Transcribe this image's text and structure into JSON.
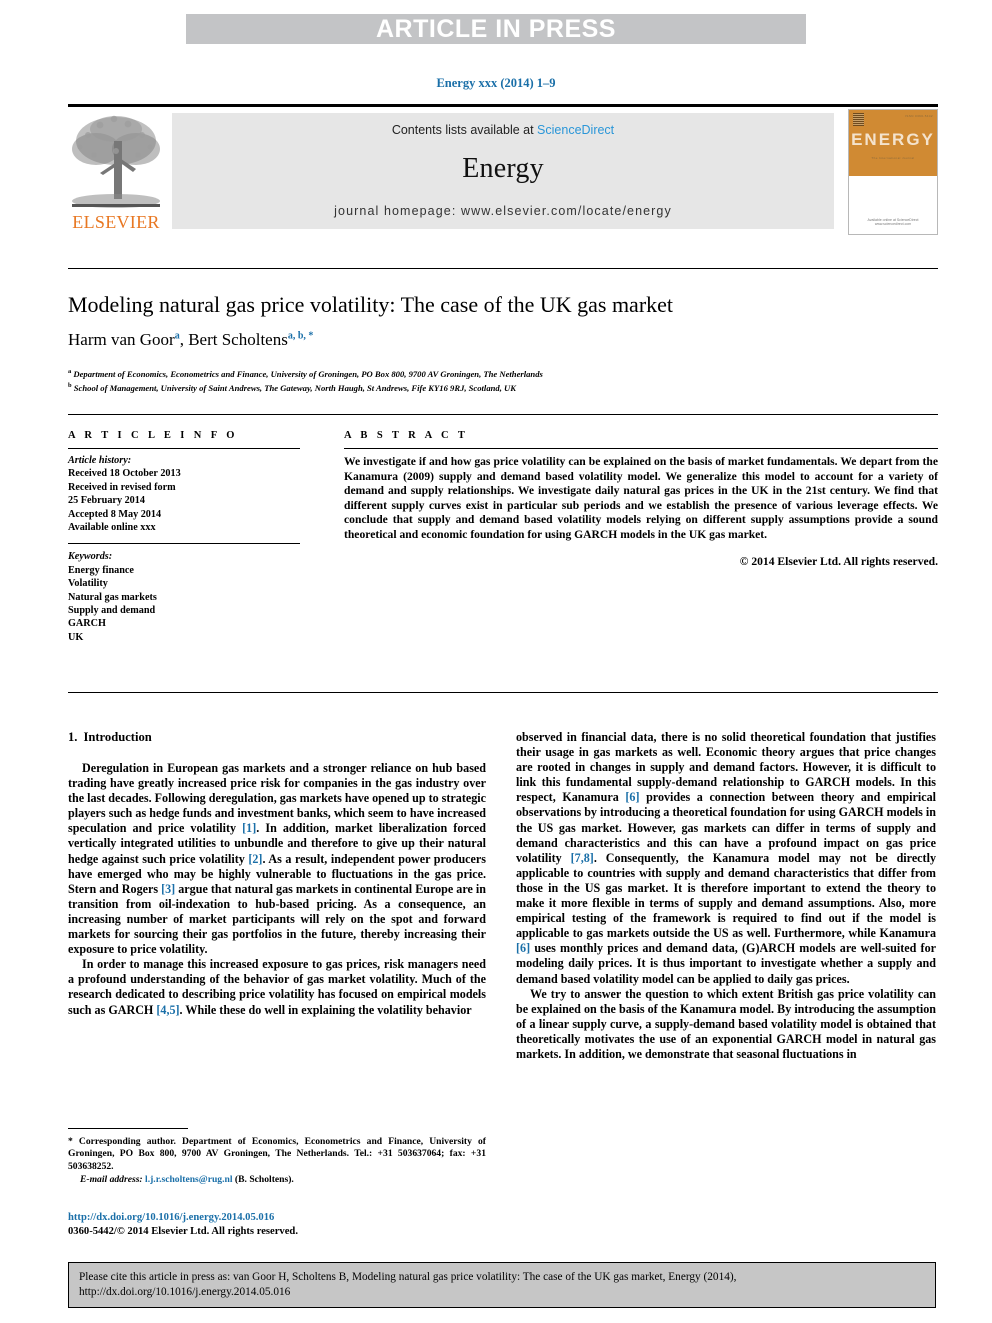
{
  "banner": {
    "article_in_press": "ARTICLE IN PRESS"
  },
  "journal_ref": "Energy xxx (2014) 1–9",
  "masthead": {
    "publisher_name": "ELSEVIER",
    "contents_prefix": "Contents lists available at ",
    "sciencedirect": "ScienceDirect",
    "journal_title": "Energy",
    "homepage": "journal homepage: www.elsevier.com/locate/energy",
    "cover": {
      "title": "ENERGY",
      "subtitle": "The International Journal",
      "top_right": "ISSN 0360-5442",
      "footer": "Available online at\nScienceDirect\nwww.sciencedirect.com"
    },
    "colors": {
      "accent_orange": "#e87722",
      "link_blue": "#2a96d8",
      "band_grey": "#e6e6e6"
    }
  },
  "article": {
    "title": "Modeling natural gas price volatility: The case of the UK gas market",
    "authors": [
      {
        "name": "Harm van Goor",
        "marks": "a"
      },
      {
        "name": "Bert Scholtens",
        "marks": "a, b, *"
      }
    ],
    "authors_separator": ", ",
    "affiliations": [
      {
        "mark": "a",
        "text": "Department of Economics, Econometrics and Finance, University of Groningen, PO Box 800, 9700 AV Groningen, The Netherlands"
      },
      {
        "mark": "b",
        "text": "School of Management, University of Saint Andrews, The Gateway, North Haugh, St Andrews, Fife KY16 9RJ, Scotland, UK"
      }
    ]
  },
  "article_info": {
    "heading": "A R T I C L E   I N F O",
    "history_label": "Article history:",
    "history": [
      "Received 18 October 2013",
      "Received in revised form",
      "25 February 2014",
      "Accepted 8 May 2014",
      "Available online xxx"
    ],
    "keywords_label": "Keywords:",
    "keywords": [
      "Energy finance",
      "Volatility",
      "Natural gas markets",
      "Supply and demand",
      "GARCH",
      "UK"
    ]
  },
  "abstract": {
    "heading": "A B S T R A C T",
    "text": "We investigate if and how gas price volatility can be explained on the basis of market fundamentals. We depart from the Kanamura (2009) supply and demand based volatility model. We generalize this model to account for a variety of demand and supply relationships. We investigate daily natural gas prices in the UK in the 21st century. We find that different supply curves exist in particular sub periods and we establish the presence of various leverage effects. We conclude that supply and demand based volatility models relying on different supply assumptions provide a sound theoretical and economic foundation for using GARCH models in the UK gas market.",
    "copyright": "© 2014 Elsevier Ltd. All rights reserved."
  },
  "introduction": {
    "number": "1.",
    "heading": "Introduction",
    "left_paragraphs": [
      "Deregulation in European gas markets and a stronger reliance on hub based trading have greatly increased price risk for companies in the gas industry over the last decades. Following deregulation, gas markets have opened up to strategic players such as hedge funds and investment banks, which seem to have increased speculation and price volatility [1]. In addition, market liberalization forced vertically integrated utilities to unbundle and therefore to give up their natural hedge against such price volatility [2]. As a result, independent power producers have emerged who may be highly vulnerable to fluctuations in the gas price. Stern and Rogers [3] argue that natural gas markets in continental Europe are in transition from oil-indexation to hub-based pricing. As a consequence, an increasing number of market participants will rely on the spot and forward markets for sourcing their gas portfolios in the future, thereby increasing their exposure to price volatility.",
      "In order to manage this increased exposure to gas prices, risk managers need a profound understanding of the behavior of gas market volatility. Much of the research dedicated to describing price volatility has focused on empirical models such as GARCH [4,5]. While these do well in explaining the volatility behavior"
    ],
    "right_paragraphs": [
      "observed in financial data, there is no solid theoretical foundation that justifies their usage in gas markets as well. Economic theory argues that price changes are rooted in changes in supply and demand factors. However, it is difficult to link this fundamental supply-demand relationship to GARCH models. In this respect, Kanamura [6] provides a connection between theory and empirical observations by introducing a theoretical foundation for using GARCH models in the US gas market. However, gas markets can differ in terms of supply and demand characteristics and this can have a profound impact on gas price volatility [7,8]. Consequently, the Kanamura model may not be directly applicable to countries with supply and demand characteristics that differ from those in the US gas market. It is therefore important to extend the theory to make it more flexible in terms of supply and demand assumptions. Also, more empirical testing of the framework is required to find out if the model is applicable to gas markets outside the US as well. Furthermore, while Kanamura [6] uses monthly prices and demand data, (G)ARCH models are well-suited for modeling daily prices. It is thus important to investigate whether a supply and demand based volatility model can be applied to daily gas prices.",
      "We try to answer the question to which extent British gas price volatility can be explained on the basis of the Kanamura model. By introducing the assumption of a linear supply curve, a supply-demand based volatility model is obtained that theoretically motivates the use of an exponential GARCH model in natural gas markets. In addition, we demonstrate that seasonal fluctuations in"
    ]
  },
  "footnote": {
    "marker": "*",
    "text": "Corresponding author. Department of Economics, Econometrics and Finance, University of Groningen, PO Box 800, 9700 AV Groningen, The Netherlands. Tel.: +31 503637064; fax: +31 503638252.",
    "email_label": "E-mail address:",
    "email": "l.j.r.scholtens@rug.nl",
    "email_owner": "(B. Scholtens)."
  },
  "doi": {
    "url": "http://dx.doi.org/10.1016/j.energy.2014.05.016",
    "issn_line": "0360-5442/© 2014 Elsevier Ltd. All rights reserved."
  },
  "cite_box": {
    "text": "Please cite this article in press as: van Goor H, Scholtens B, Modeling natural gas price volatility: The case of the UK gas market, Energy (2014), http://dx.doi.org/10.1016/j.energy.2014.05.016"
  }
}
